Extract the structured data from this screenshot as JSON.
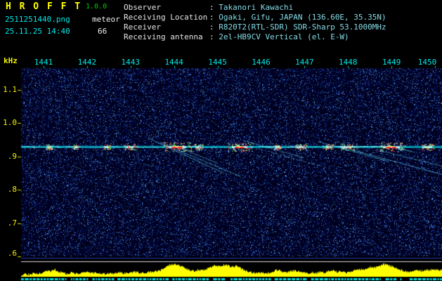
{
  "app": {
    "title": "H R O F F T",
    "version": "1.0.0",
    "filename": "2511251440.png",
    "mode": "meteor",
    "datetime": "25.11.25 14:40",
    "count": "66"
  },
  "header": {
    "separator": ": ",
    "rows": [
      {
        "label": "Observer",
        "value": "Takanori Kawachi"
      },
      {
        "label": "Receiving Location",
        "value": "Ogaki, Gifu, JAPAN (136.60E, 35.35N)"
      },
      {
        "label": "Receiver",
        "value": "R820T2(RTL-SDR) SDR-Sharp 53.1000MHz"
      },
      {
        "label": "Receiving antenna",
        "value": "2el-HB9CV Vertical (el. E-W)"
      }
    ]
  },
  "colors": {
    "title_yellow": "#ffff00",
    "version_green": "#00cc00",
    "label_cyan": "#00e8e8",
    "axis_yellow": "#f0f000",
    "carrier_cyan": "#00ffff",
    "echo_red": "#ff3a3a",
    "echo_yellow": "#ffe838",
    "echo_green": "#50ff50",
    "signal_yellow": "#ffff00",
    "activity_cyan": "#00dcdc",
    "separator_blue": "#2238c8",
    "separator_white": "#dcdcdc",
    "noise_background": "#000019"
  },
  "chart_data": {
    "type": "heatmap",
    "ylabel": "kHz",
    "y_ticks": [
      "1.1",
      "1.0",
      ".9",
      ".8",
      ".7",
      ".6"
    ],
    "y_tick_values": [
      1.1,
      1.0,
      0.9,
      0.8,
      0.7,
      0.6
    ],
    "y_range_khz": [
      0.6,
      1.165
    ],
    "x_ticks": [
      "1441",
      "1442",
      "1443",
      "1444",
      "1445",
      "1446",
      "1447",
      "1448",
      "1449",
      "1450"
    ],
    "x_span_minutes": 10,
    "grid": false,
    "carrier_khz": 0.93,
    "echoes": [
      {
        "t": 0.067,
        "w": 0.01,
        "s": 0.4
      },
      {
        "t": 0.13,
        "w": 0.008,
        "s": 0.35
      },
      {
        "t": 0.204,
        "w": 0.01,
        "s": 0.4
      },
      {
        "t": 0.259,
        "w": 0.017,
        "s": 0.5
      },
      {
        "t": 0.371,
        "w": 0.043,
        "s": 1.0
      },
      {
        "t": 0.421,
        "w": 0.013,
        "s": 0.5
      },
      {
        "t": 0.519,
        "w": 0.037,
        "s": 0.9
      },
      {
        "t": 0.609,
        "w": 0.01,
        "s": 0.4
      },
      {
        "t": 0.664,
        "w": 0.017,
        "s": 0.55
      },
      {
        "t": 0.731,
        "w": 0.013,
        "s": 0.45
      },
      {
        "t": 0.776,
        "w": 0.02,
        "s": 0.6
      },
      {
        "t": 0.88,
        "w": 0.04,
        "s": 1.0
      },
      {
        "t": 0.967,
        "w": 0.02,
        "s": 0.6
      }
    ],
    "streaks": [
      {
        "t1": 0.3,
        "f1": 0.957,
        "t2": 0.481,
        "f2": 0.851,
        "a": 0.55
      },
      {
        "t1": 0.331,
        "f1": 0.942,
        "t2": 0.521,
        "f2": 0.841,
        "a": 0.5
      },
      {
        "t1": 0.371,
        "f1": 0.929,
        "t2": 0.467,
        "f2": 0.881,
        "a": 0.45
      },
      {
        "t1": 0.2,
        "f1": 0.895,
        "t2": 0.326,
        "f2": 0.87,
        "a": 0.3,
        "dash": true
      },
      {
        "t1": 0.526,
        "f1": 0.95,
        "t2": 0.671,
        "f2": 0.897,
        "a": 0.5
      },
      {
        "t1": 0.548,
        "f1": 0.931,
        "t2": 0.709,
        "f2": 0.872,
        "a": 0.35,
        "dash": true
      },
      {
        "t1": 0.704,
        "f1": 0.946,
        "t2": 0.871,
        "f2": 0.887,
        "a": 0.5
      },
      {
        "t1": 0.768,
        "f1": 0.927,
        "t2": 1.0,
        "f2": 0.847,
        "a": 0.55
      },
      {
        "t1": 0.851,
        "f1": 0.919,
        "t2": 1.0,
        "f2": 0.872,
        "a": 0.45
      },
      {
        "t1": 0.584,
        "f1": 0.917,
        "t2": 0.735,
        "f2": 0.864,
        "a": 0.3,
        "dash": true
      },
      {
        "t1": 0.355,
        "f1": 0.936,
        "t2": 0.4,
        "f2": 0.918,
        "a": 0.8
      },
      {
        "t1": 0.87,
        "f1": 0.934,
        "t2": 0.93,
        "f2": 0.915,
        "a": 0.7
      },
      {
        "t1": 0.06,
        "f1": 0.935,
        "t2": 0.12,
        "f2": 0.928,
        "a": 0.3
      }
    ],
    "signal_level": {
      "values": [
        3,
        4,
        3,
        5,
        4,
        6,
        9,
        8,
        10,
        7,
        5,
        4,
        6,
        5,
        4,
        7,
        6,
        5,
        6,
        5,
        4,
        5,
        4,
        6,
        5,
        5,
        6,
        7,
        6,
        5,
        6,
        7,
        8,
        9,
        13,
        16,
        18,
        17,
        15,
        12,
        9,
        8,
        10,
        9,
        11,
        14,
        16,
        15,
        17,
        16,
        14,
        15,
        13,
        9,
        7,
        6,
        5,
        6,
        5,
        6,
        8,
        10,
        7,
        6,
        8,
        9,
        7,
        6,
        5,
        6,
        5,
        7,
        6,
        8,
        9,
        7,
        8,
        6,
        7,
        9,
        11,
        10,
        12,
        14,
        13,
        16,
        18,
        17,
        15,
        12,
        10,
        8,
        7,
        8,
        9,
        8,
        10,
        9,
        11,
        10
      ]
    }
  }
}
